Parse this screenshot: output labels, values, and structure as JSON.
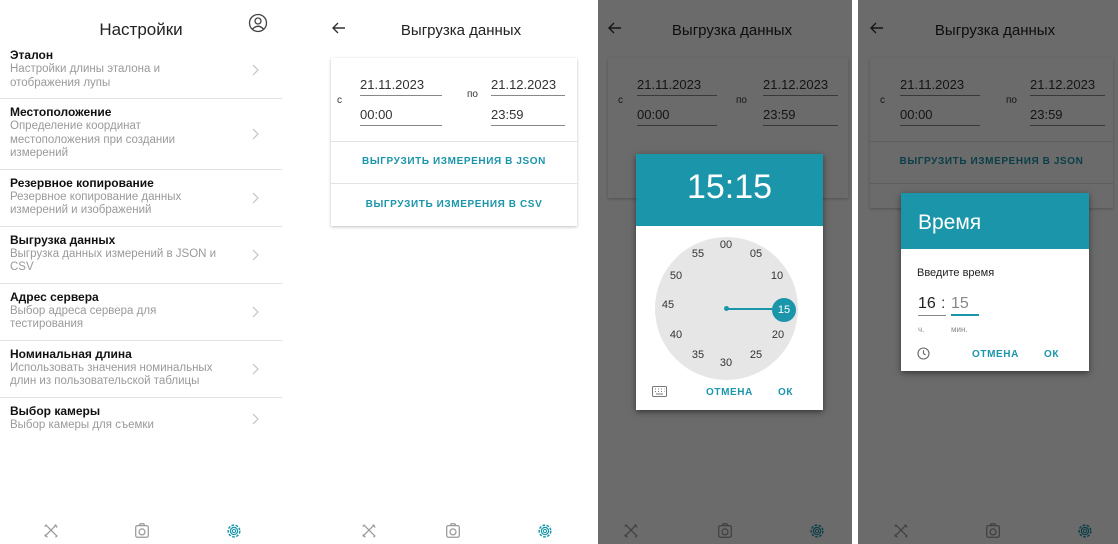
{
  "settings": {
    "title": "Настройки",
    "items": [
      {
        "title": "Эталон",
        "subtitle": "Настройки длины эталона и отображения лупы"
      },
      {
        "title": "Местоположение",
        "subtitle": "Определение координат местоположения при создании измерений"
      },
      {
        "title": "Резервное копирование",
        "subtitle": "Резервное копирование данных измерений и изображений"
      },
      {
        "title": "Выгрузка данных",
        "subtitle": "Выгрузка данных измерений в JSON и CSV"
      },
      {
        "title": "Адрес сервера",
        "subtitle": "Выбор адреса сервера для тестирования"
      },
      {
        "title": "Номинальная длина",
        "subtitle": "Использовать значения номинальных длин из пользовательской таблицы"
      },
      {
        "title": "Выбор камеры",
        "subtitle": "Выбор камеры для съемки"
      }
    ]
  },
  "export": {
    "title": "Выгрузка данных",
    "from_label": "с",
    "to_label": "по",
    "from_date": "21.11.2023",
    "from_time": "00:00",
    "to_date": "21.12.2023",
    "to_time": "23:59",
    "json_button": "ВЫГРУЗИТЬ ИЗМЕРЕНИЯ В JSON",
    "csv_button": "ВЫГРУЗИТЬ ИЗМЕРЕНИЯ В CSV"
  },
  "clock_dialog": {
    "time": "15:15",
    "selected_minute": "15",
    "numbers": [
      "00",
      "05",
      "10",
      "15",
      "20",
      "25",
      "30",
      "35",
      "40",
      "45",
      "50",
      "55"
    ],
    "cancel": "ОТМЕНА",
    "ok": "ОК"
  },
  "input_dialog": {
    "title": "Время",
    "prompt": "Введите время",
    "hour": "16",
    "separator": ":",
    "minute": "15",
    "hour_label": "ч.",
    "minute_label": "мин.",
    "cancel": "ОТМЕНА",
    "ok": "ОК"
  },
  "colors": {
    "accent": "#1b95aa"
  },
  "icons": [
    "profile-icon",
    "chevron-right-icon",
    "back-arrow-icon",
    "ruler-tools-icon",
    "camera-icon",
    "gear-icon",
    "keyboard-icon",
    "clock-icon"
  ]
}
